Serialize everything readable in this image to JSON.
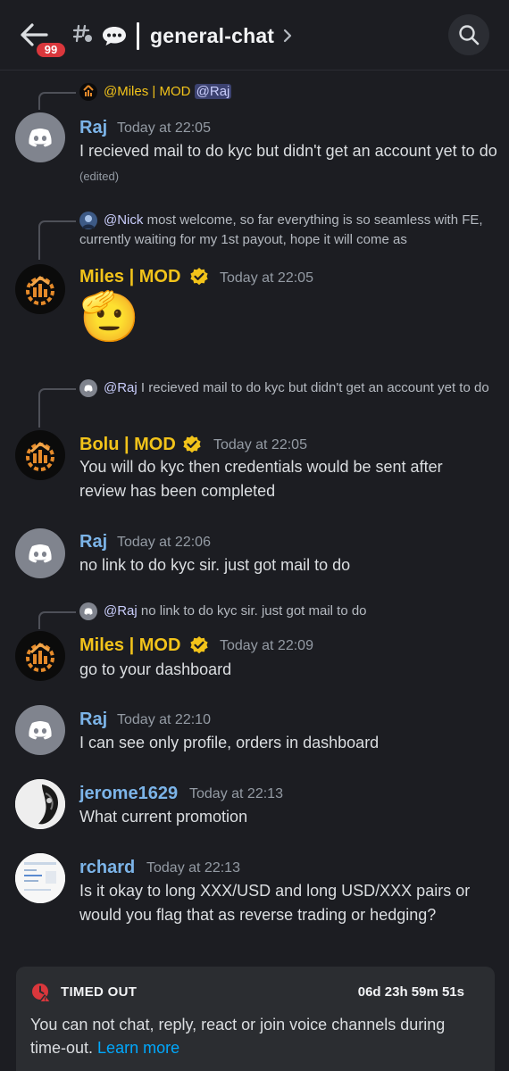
{
  "header": {
    "unread_badge": "99",
    "channel_name": "general-chat"
  },
  "messages": [
    {
      "reply": {
        "name": "@Miles | MOD",
        "mention": "@Raj"
      },
      "author": "Raj",
      "timestamp": "Today at 22:05",
      "text": "I recieved mail to do kyc but didn't get an account yet to do",
      "edited": "(edited)"
    },
    {
      "reply": {
        "name": "@Nick",
        "text": "most welcome, so far everything is so seamless with FE, currently waiting for my 1st payout, hope it will come as"
      },
      "author": "Miles | MOD",
      "timestamp": "Today at 22:05",
      "emoji": "🫡"
    },
    {
      "reply": {
        "name": "@Raj",
        "text": "I recieved mail to do kyc but didn't get an account yet to do"
      },
      "author": "Bolu | MOD",
      "timestamp": "Today at 22:05",
      "text": "You will do kyc then credentials would be sent after review has been completed"
    },
    {
      "author": "Raj",
      "timestamp": "Today at 22:06",
      "text": "no link to do kyc sir. just got mail to do"
    },
    {
      "reply": {
        "name": "@Raj",
        "text": "no link to do kyc sir. just got mail to do"
      },
      "author": "Miles | MOD",
      "timestamp": "Today at 22:09",
      "text": "go to your dashboard"
    },
    {
      "author": "Raj",
      "timestamp": "Today at 22:10",
      "text": "I can see only profile, orders in dashboard"
    },
    {
      "author": "jerome1629",
      "timestamp": "Today at 22:13",
      "text": "What current promotion"
    },
    {
      "author": "rchard",
      "timestamp": "Today at 22:13",
      "text": "Is it okay to long XXX/USD and long USD/XXX pairs or would you flag that as reverse trading or hedging?"
    }
  ],
  "timeout": {
    "title": "TIMED OUT",
    "timer": "06d 23h 59m 51s",
    "text": "You can not chat, reply, react or join voice channels during time-out.",
    "link": "Learn more"
  },
  "colors": {
    "background": "#1c1d22",
    "username_blue": "#7cb4e8",
    "username_gold": "#f2c31a",
    "link": "#00a8fc",
    "badge_red": "#da373c"
  },
  "icons": [
    "back-arrow-icon",
    "hashtag-thread-icon",
    "chat-bubble-icon",
    "chevron-right-icon",
    "search-icon",
    "discord-logo-icon",
    "verified-check-icon",
    "timeout-clock-icon"
  ]
}
